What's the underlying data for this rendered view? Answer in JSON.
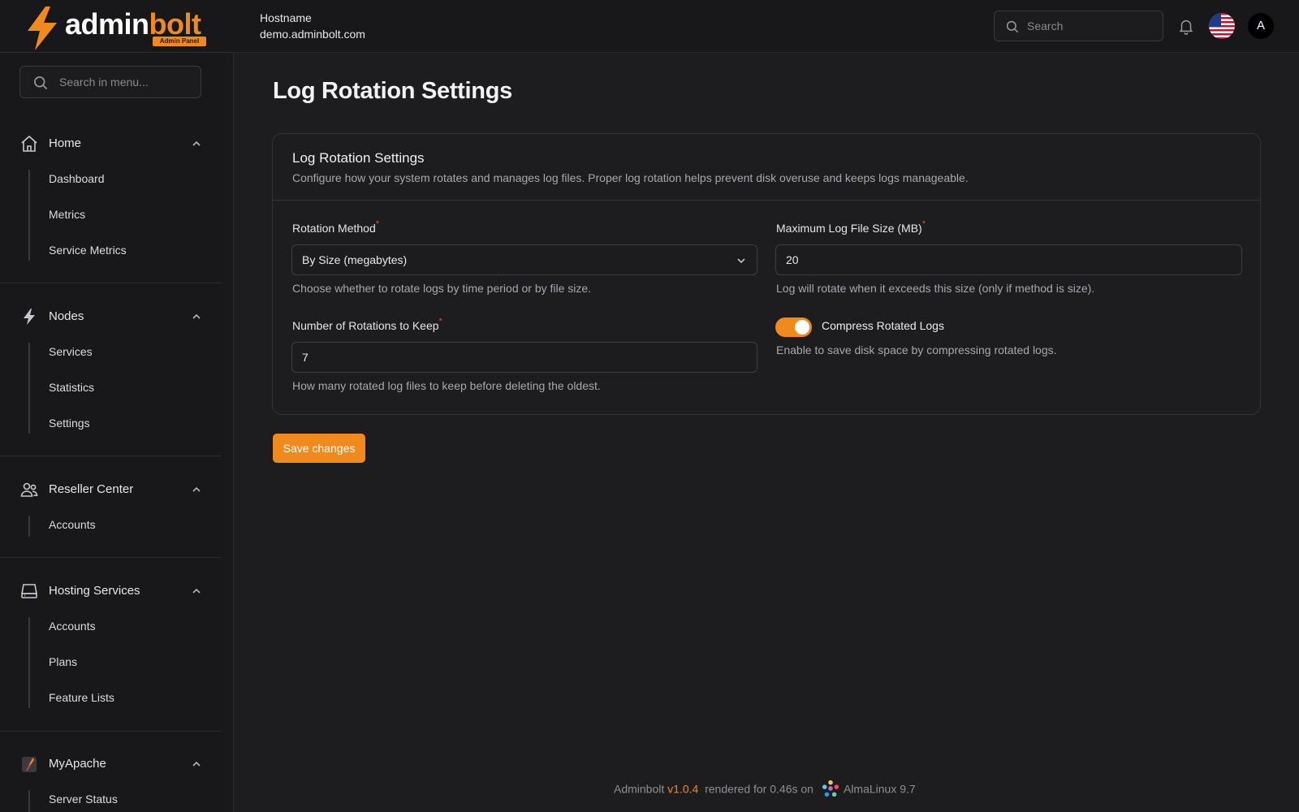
{
  "brand": {
    "name_white": "admin",
    "name_orange": "bolt",
    "badge": "Admin Panel",
    "accent_color": "#f08a1c"
  },
  "header": {
    "host_label": "Hostname",
    "host_value": "demo.adminbolt.com",
    "search_placeholder": "Search",
    "avatar_initial": "A",
    "icons": [
      "search-icon",
      "bell-icon",
      "us-flag-icon"
    ]
  },
  "sidebar": {
    "search_placeholder": "Search in menu...",
    "groups": [
      {
        "label": "Home",
        "icon": "home-icon",
        "items": [
          "Dashboard",
          "Metrics",
          "Service Metrics"
        ]
      },
      {
        "label": "Nodes",
        "icon": "bolt-icon",
        "items": [
          "Services",
          "Statistics",
          "Settings"
        ]
      },
      {
        "label": "Reseller Center",
        "icon": "users-icon",
        "items": [
          "Accounts"
        ]
      },
      {
        "label": "Hosting Services",
        "icon": "server-icon",
        "items": [
          "Accounts",
          "Plans",
          "Feature Lists"
        ]
      },
      {
        "label": "MyApache",
        "icon": "apache-feather-icon",
        "items": [
          "Server Status"
        ]
      }
    ]
  },
  "page": {
    "title": "Log Rotation Settings"
  },
  "card": {
    "title": "Log Rotation Settings",
    "description": "Configure how your system rotates and manages log files. Proper log rotation helps prevent disk overuse and keeps logs manageable.",
    "fields": {
      "rotation_method": {
        "label": "Rotation Method",
        "required_mark": "*",
        "value": "By Size (megabytes)",
        "help": "Choose whether to rotate logs by time period or by file size."
      },
      "max_size": {
        "label": "Maximum Log File Size (MB)",
        "required_mark": "*",
        "value": "20",
        "help": "Log will rotate when it exceeds this size (only if method is size)."
      },
      "rotations": {
        "label": "Number of Rotations to Keep",
        "required_mark": "*",
        "value": "7",
        "help": "How many rotated log files to keep before deleting the oldest."
      },
      "compress": {
        "label": "Compress Rotated Logs",
        "enabled": true,
        "help": "Enable to save disk space by compressing rotated logs."
      }
    },
    "save_label": "Save changes"
  },
  "footer": {
    "product": "Adminbolt",
    "version": "v1.0.4",
    "rendered": "rendered for 0.46s on",
    "os": "AlmaLinux 9.7"
  }
}
